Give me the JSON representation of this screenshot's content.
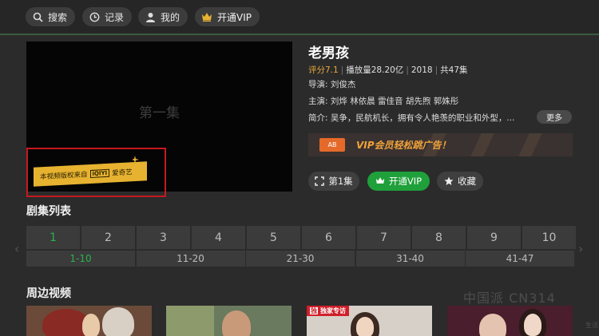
{
  "topbar": {
    "search_label": "搜索",
    "history_label": "记录",
    "mine_label": "我的",
    "vip_label": "开通VIP"
  },
  "player": {
    "episode_overlay": "第一集",
    "copyright_text": "本视频版权来自",
    "copyright_brand_badge": "iQIYI",
    "copyright_brand": "爱奇艺"
  },
  "show": {
    "title": "老男孩",
    "score": "评分7.1",
    "plays": "播放量28.20亿",
    "year": "2018",
    "episodes_total": "共47集",
    "director": "导演: 刘俊杰",
    "cast": "主演: 刘烨 林依晨 雷佳音 胡先煦 郭姝彤",
    "synopsis": "简介: 吴争，民航机长，拥有令人艳羡的职业和外型，...",
    "more_label": "更多"
  },
  "ad": {
    "logo": "AB",
    "text": "VIP会员轻松跳广告！"
  },
  "actions": {
    "episode_label": "第1集",
    "vip_label": "开通VIP",
    "favorite_label": "收藏"
  },
  "episode_list": {
    "title": "剧集列表",
    "episodes": [
      "1",
      "2",
      "3",
      "4",
      "5",
      "6",
      "7",
      "8",
      "9",
      "10"
    ],
    "active_episode": "1",
    "ranges": [
      "1-10",
      "11-20",
      "21-30",
      "31-40",
      "41-47"
    ],
    "active_range": "1-10"
  },
  "related": {
    "title": "周边视频",
    "exclusive_mark": "独",
    "exclusive_tag": "独家专访"
  },
  "watermark": {
    "text": "中国派 CN314",
    "sub": "生活"
  },
  "colors": {
    "accent_green": "#1fa03a",
    "vip_gold": "#e6b230",
    "score_orange": "#e8a93a",
    "highlight_red": "#c8181e"
  }
}
